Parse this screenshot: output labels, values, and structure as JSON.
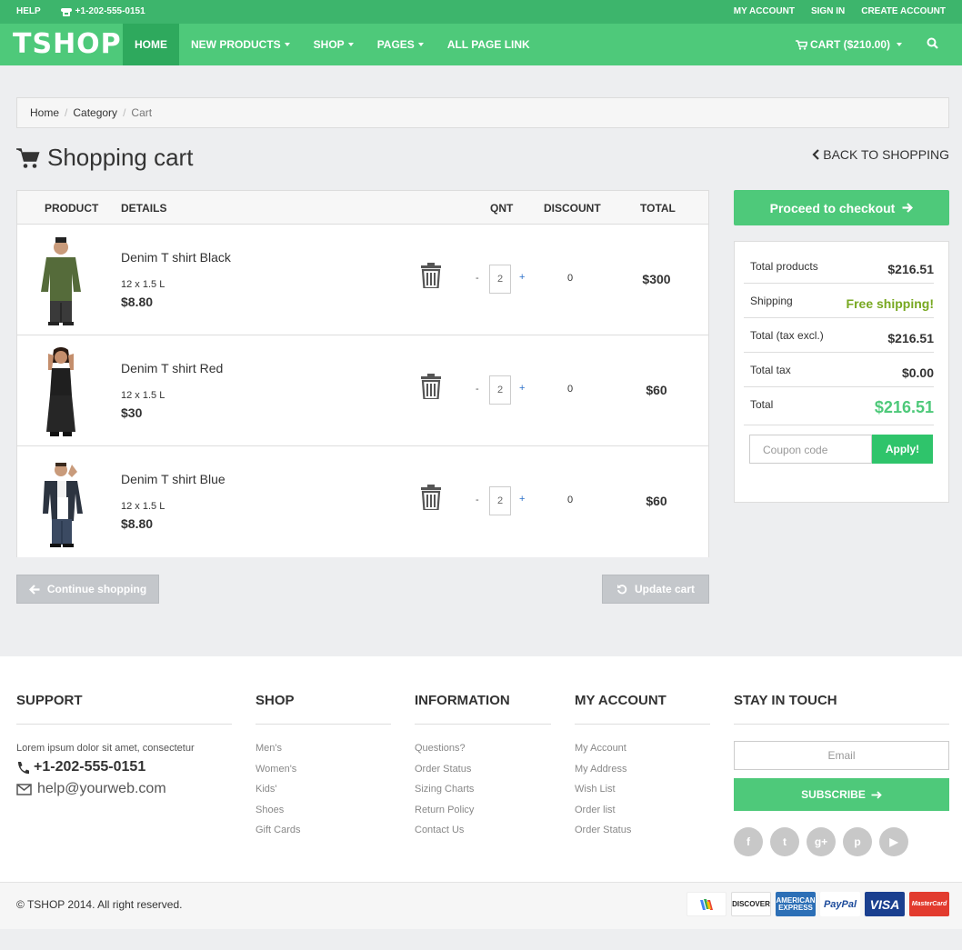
{
  "topbar": {
    "help": "HELP",
    "phone": "+1-202-555-0151",
    "links": [
      "MY ACCOUNT",
      "SIGN IN",
      "CREATE ACCOUNT"
    ]
  },
  "nav": {
    "logo": "TSHOP",
    "items": [
      {
        "label": "HOME",
        "active": true,
        "dropdown": false
      },
      {
        "label": "NEW PRODUCTS",
        "active": false,
        "dropdown": true
      },
      {
        "label": "SHOP",
        "active": false,
        "dropdown": true
      },
      {
        "label": "PAGES",
        "active": false,
        "dropdown": true
      },
      {
        "label": "ALL PAGE LINK",
        "active": false,
        "dropdown": false
      }
    ],
    "cart_label": "CART ($210.00)"
  },
  "breadcrumb": [
    "Home",
    "Category",
    "Cart"
  ],
  "page": {
    "title": "Shopping cart",
    "back_label": "BACK TO SHOPPING"
  },
  "cart": {
    "headers": {
      "product": "PRODUCT",
      "details": "DETAILS",
      "qnt": "QNT",
      "discount": "DISCOUNT",
      "total": "TOTAL"
    },
    "items": [
      {
        "name": "Denim T shirt Black",
        "size": "12 x 1.5 L",
        "price": "$8.80",
        "qty": "2",
        "discount": "0",
        "total": "$300",
        "shirt_color": "#556b3a"
      },
      {
        "name": "Denim T shirt Red",
        "size": "12 x 1.5 L",
        "price": "$30",
        "qty": "2",
        "discount": "0",
        "total": "$60",
        "shirt_color": "#1f1f1f"
      },
      {
        "name": "Denim T shirt Blue",
        "size": "12 x 1.5 L",
        "price": "$8.80",
        "qty": "2",
        "discount": "0",
        "total": "$60",
        "shirt_color": "#2c3440"
      }
    ],
    "qty_minus": "-",
    "qty_plus": "+",
    "continue_label": "Continue shopping",
    "update_label": "Update cart"
  },
  "summary": {
    "checkout_label": "Proceed to checkout",
    "rows": [
      {
        "label": "Total products",
        "value": "$216.51"
      },
      {
        "label": "Shipping",
        "value": "Free shipping!"
      },
      {
        "label": "Total (tax excl.)",
        "value": "$216.51"
      },
      {
        "label": "Total tax",
        "value": "$0.00"
      },
      {
        "label": "Total",
        "value": "$216.51"
      }
    ],
    "coupon_placeholder": "Coupon code",
    "apply_label": "Apply!"
  },
  "footer": {
    "support": {
      "title": "SUPPORT",
      "text": "Lorem ipsum dolor sit amet, consectetur",
      "phone": "+1-202-555-0151",
      "email": "help@yourweb.com"
    },
    "shop": {
      "title": "SHOP",
      "items": [
        "Men's",
        "Women's",
        "Kids'",
        "Shoes",
        "Gift Cards"
      ]
    },
    "information": {
      "title": "INFORMATION",
      "items": [
        "Questions?",
        "Order Status",
        "Sizing Charts",
        "Return Policy",
        "Contact Us"
      ]
    },
    "account": {
      "title": "MY ACCOUNT",
      "items": [
        "My Account",
        "My Address",
        "Wish List",
        "Order list",
        "Order Status"
      ]
    },
    "touch": {
      "title": "STAY IN TOUCH",
      "email_placeholder": "Email",
      "subscribe_label": "SUBSCRIBE",
      "socials": [
        {
          "name": "facebook-icon",
          "glyph": "f"
        },
        {
          "name": "twitter-icon",
          "glyph": "t"
        },
        {
          "name": "google-plus-icon",
          "glyph": "g+"
        },
        {
          "name": "pinterest-icon",
          "glyph": "p"
        },
        {
          "name": "youtube-icon",
          "glyph": "▶"
        }
      ]
    }
  },
  "bottom": {
    "copyright": "© TSHOP 2014. All right reserved.",
    "payments": [
      {
        "name": "google-wallet-icon",
        "label": "",
        "bg": "#ffffff",
        "fg": "#333333"
      },
      {
        "name": "discover-icon",
        "label": "DISCOVER",
        "bg": "#ffffff",
        "fg": "#222222"
      },
      {
        "name": "amex-icon",
        "label": "AMERICAN EXPRESS",
        "bg": "#2c6fb6",
        "fg": "#ffffff"
      },
      {
        "name": "paypal-icon",
        "label": "PayPal",
        "bg": "#ffffff",
        "fg": "#1d4b9b"
      },
      {
        "name": "visa-icon",
        "label": "VISA",
        "bg": "#1a3f8f",
        "fg": "#ffffff"
      },
      {
        "name": "mastercard-icon",
        "label": "MasterCard",
        "bg": "#e23b2e",
        "fg": "#ffffff"
      }
    ]
  },
  "colors": {
    "brand": "#4ec97a",
    "brand_dark": "#2ea95d",
    "free_shipping": "#77a820",
    "grand_total": "#4ec97a"
  }
}
